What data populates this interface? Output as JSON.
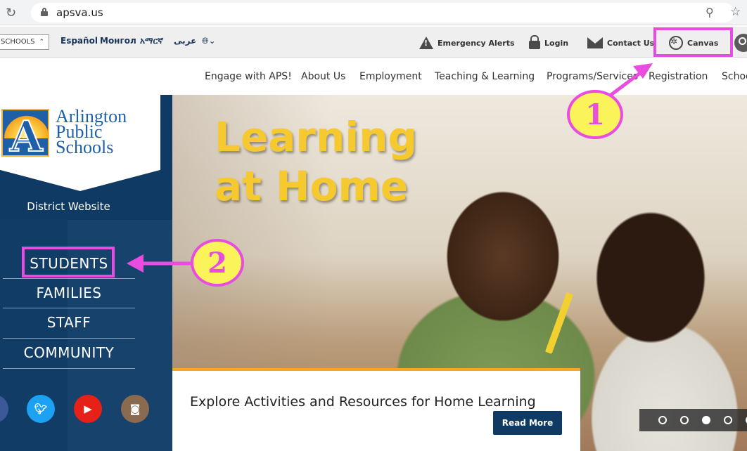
{
  "browser": {
    "url": "apsva.us",
    "reload_icon": "reload-icon",
    "zoom_icon": "zoom-icon",
    "star_icon": "bookmark-star-icon"
  },
  "utility": {
    "schools_label": "SCHOOLS",
    "languages": [
      "Español",
      "Монгол",
      "አማርኛ",
      "عربى"
    ],
    "emergency_alerts": "Emergency Alerts",
    "login": "Login",
    "contact_us": "Contact Us",
    "canvas": "Canvas"
  },
  "nav": {
    "items": [
      "Engage with APS!",
      "About Us",
      "Employment",
      "Teaching & Learning",
      "Programs/Services",
      "Registration",
      "Schoo"
    ]
  },
  "sidebar": {
    "logo_lines": [
      "Arlington",
      "Public",
      "Schools"
    ],
    "logo_letter": "A",
    "district_label": "District Website",
    "audience_links": [
      "STUDENTS",
      "FAMILIES",
      "STAFF",
      "COMMUNITY"
    ],
    "social": [
      "facebook-icon",
      "twitter-icon",
      "youtube-icon",
      "instagram-icon"
    ]
  },
  "hero": {
    "title_line1": "Learning",
    "title_line2": "at Home",
    "caption": "Explore Activities and Resources for Home Learning",
    "read_more": "Read More",
    "carousel_active_index": 2
  },
  "annotations": {
    "callout_1": "1",
    "callout_2": "2",
    "highlight_color": "#e84de0",
    "callout_fill": "#fbf35a"
  },
  "colors": {
    "brand_navy": "#0e3a64",
    "hero_title": "#f6c92f"
  }
}
